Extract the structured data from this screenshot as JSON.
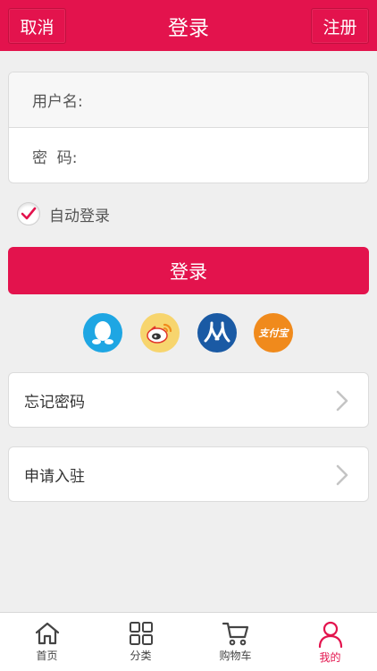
{
  "header": {
    "cancel_label": "取消",
    "title": "登录",
    "register_label": "注册"
  },
  "form": {
    "username_label": "用户名:",
    "password_label": "密  码:",
    "username_value": "",
    "password_value": ""
  },
  "auto_login": {
    "label": "自动登录",
    "checked": true
  },
  "login_button": "登录",
  "social": [
    "qq-icon",
    "weibo-icon",
    "renren-icon",
    "alipay-icon"
  ],
  "alipay_text": "支付宝",
  "links": {
    "forgot_password": "忘记密码",
    "apply_join": "申请入驻"
  },
  "tabbar": {
    "home": "首页",
    "category": "分类",
    "cart": "购物车",
    "mine": "我的"
  },
  "colors": {
    "accent": "#e3134d",
    "background": "#efefef"
  }
}
